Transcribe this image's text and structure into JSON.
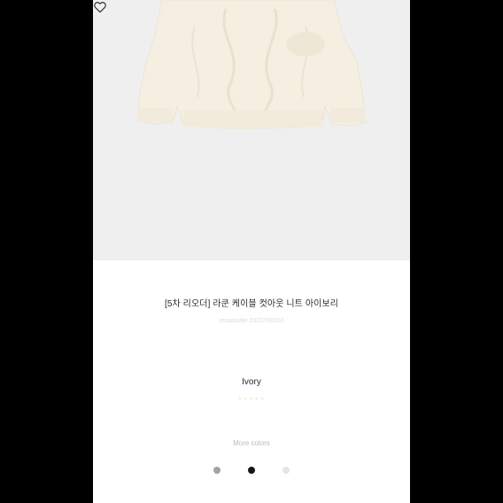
{
  "product": {
    "title": "[5차 리오더] 라쿤 케이블 컷아웃 니트 아이보리",
    "code": "Ienaiasale 2022/09/152",
    "color_name": "Ivory",
    "rating_text": "★★★★★",
    "more_colors_label": "More colors"
  },
  "swatches": [
    {
      "name": "grey",
      "color": "#a3a3a3"
    },
    {
      "name": "black",
      "color": "#151515"
    },
    {
      "name": "light-grey",
      "color": "#e4e4ec"
    }
  ],
  "icons": {
    "wishlist": "heart-outline-icon"
  },
  "colors": {
    "image_bg": "#efefef",
    "sweater": "#f5efe2",
    "text": "#2b2b2b"
  }
}
